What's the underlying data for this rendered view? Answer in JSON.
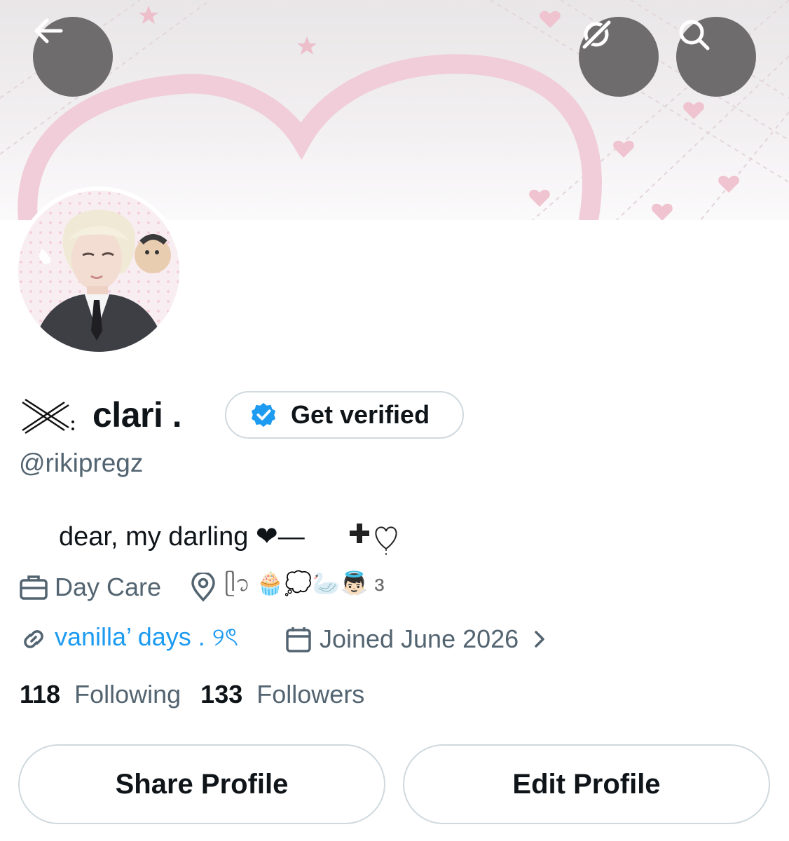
{
  "header": {
    "back_icon": "arrow-left-icon",
    "grok_icon": "grok-icon",
    "search_icon": "search-icon"
  },
  "profile": {
    "name_prefix_deco": "⤫:",
    "name": "clari .",
    "verify_label": "Get verified",
    "handle": "@rikipregz",
    "bio_text": "dear, my darling ❤︎—",
    "bio_deco": "✙♡",
    "work": "Day Care",
    "location_deco": "ᥫ᭡ 🧁💭🦢👼🏻 ɜ",
    "website": "vanilla’ days . ୨ৎ",
    "joined": "Joined June 2026"
  },
  "stats": {
    "following_count": "118",
    "following_label": "Following",
    "followers_count": "133",
    "followers_label": "Followers"
  },
  "actions": {
    "share": "Share Profile",
    "edit": "Edit Profile"
  },
  "colors": {
    "accent": "#1d9bf0",
    "muted": "#536471",
    "text": "#0f1419",
    "border": "#cfd9de",
    "overlay_button": "#6f6c6e",
    "banner_pink": "#f0c8d3"
  }
}
